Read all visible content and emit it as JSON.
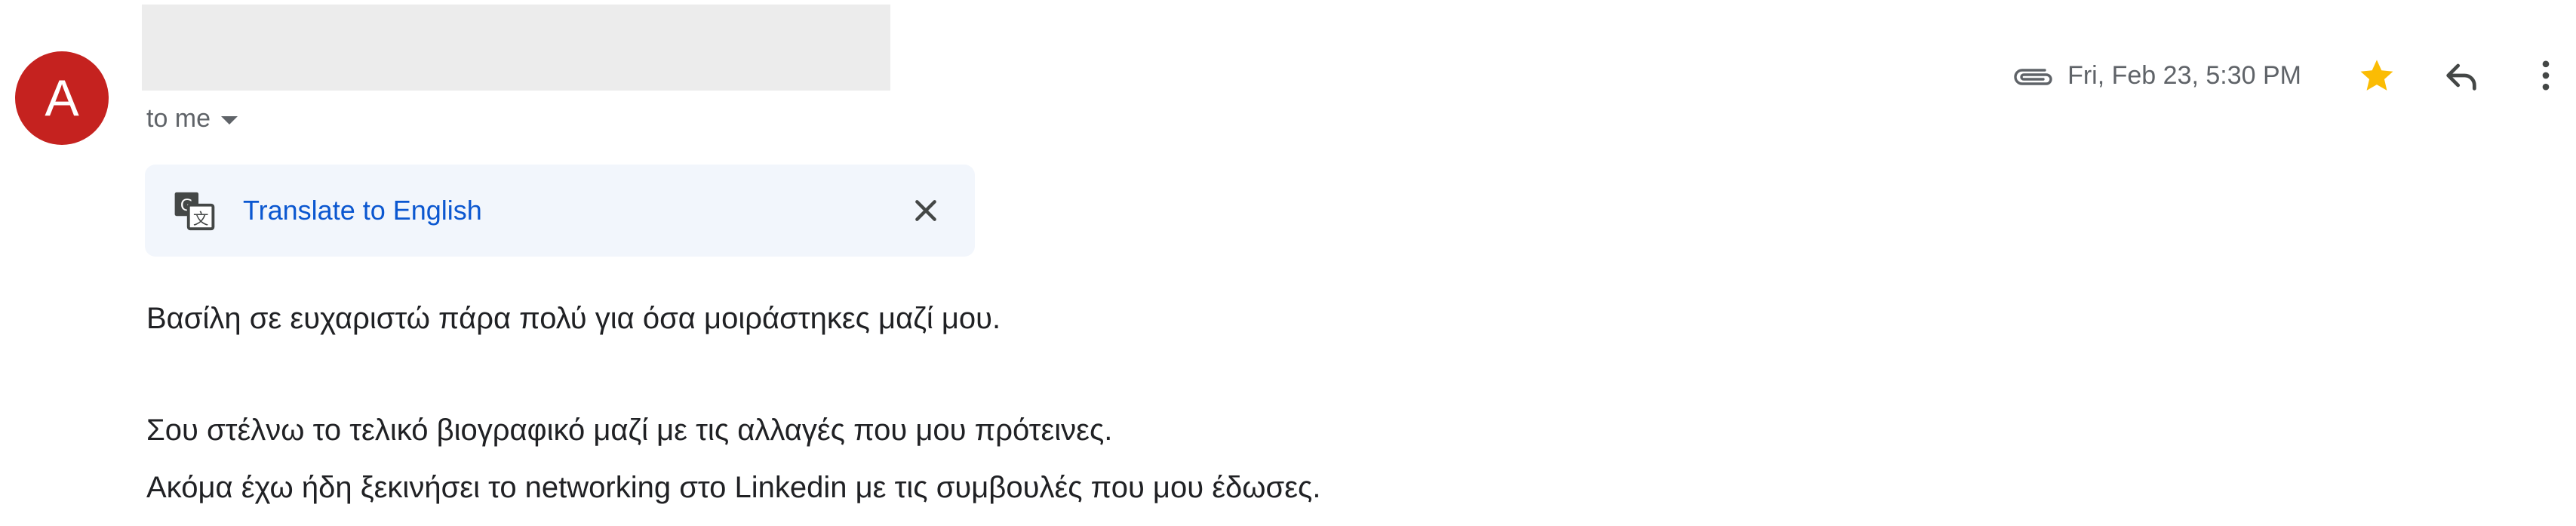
{
  "sender": {
    "avatar_letter": "A",
    "avatar_color": "#c5221f"
  },
  "recipient": {
    "label": "to me"
  },
  "header": {
    "date": "Fri, Feb 23, 5:30 PM",
    "icons": [
      "attachment-icon",
      "star-icon",
      "reply-icon",
      "more-vert-icon"
    ],
    "star_color": "#fbbc04"
  },
  "translate": {
    "link_label": "Translate to English",
    "link_color": "#0b57d0"
  },
  "body": {
    "lines": [
      "Βασίλη σε ευχαριστώ πάρα πολύ για όσα μοιράστηκες μαζί μου.",
      "Σου στέλνω το τελικό βιογραφικό μαζί με τις αλλαγές που μου πρότεινες.",
      "Ακόμα έχω ήδη ξεκινήσει το networking στο Linkedin με τις συμβουλές που μου έδωσες."
    ]
  }
}
